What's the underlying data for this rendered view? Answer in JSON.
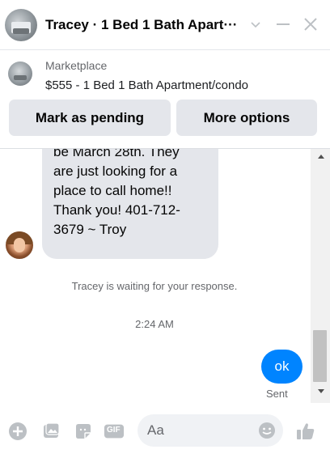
{
  "header": {
    "title": "Tracey · 1 Bed 1 Bath Apart···",
    "avatar_icon": "listing-photo-avatar",
    "minimize_icon": "minimize-icon",
    "close_icon": "close-icon",
    "options_icon": "chevron-down-icon"
  },
  "marketplace": {
    "label": "Marketplace",
    "listing": "$555 - 1 Bed 1 Bath Apartment/condo",
    "pending_button": "Mark as pending",
    "more_button": "More options"
  },
  "conversation": {
    "incoming_lines": [
      "be March 28th. They",
      "are just looking for a",
      "place to call home!!",
      "Thank you! 401-712-",
      "3679 ~ Troy"
    ],
    "waiting_notice": "Tracey is waiting for your response.",
    "timestamp": "2:24 AM",
    "outgoing_message": "ok",
    "delivery_status": "Sent"
  },
  "composer": {
    "placeholder": "Aa",
    "gif_label": "GIF",
    "icons": [
      "plus-circle-icon",
      "photo-icon",
      "sticker-icon",
      "gif-icon",
      "emoji-icon",
      "thumbs-up-icon"
    ]
  },
  "colors": {
    "accent": "#0084ff",
    "bubble_incoming": "#e4e6eb",
    "icon_gray": "#bcc0c4",
    "button_bg": "#e4e6eb"
  }
}
